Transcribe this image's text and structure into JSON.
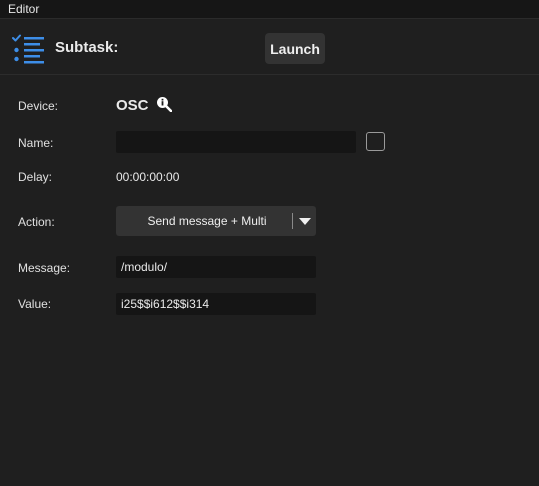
{
  "window": {
    "title": "Editor"
  },
  "header": {
    "subtask_label": "Subtask:",
    "launch_label": "Launch"
  },
  "form": {
    "device": {
      "label": "Device:",
      "value": "OSC"
    },
    "name": {
      "label": "Name:",
      "value": "",
      "checked": false
    },
    "delay": {
      "label": "Delay:",
      "value": "00:00:00:00"
    },
    "action": {
      "label": "Action:",
      "value": "Send message + Multi"
    },
    "message": {
      "label": "Message:",
      "value": "/modulo/"
    },
    "value": {
      "label": "Value:",
      "value": "i25$$i612$$i314"
    }
  },
  "icons": {
    "task_list": "task-list-icon",
    "info": "info-magnifier-icon",
    "dropdown": "caret-down-icon"
  },
  "colors": {
    "background": "#1f1f1f",
    "titlebar": "#161616",
    "accent": "#3d8ee8",
    "button": "#333333",
    "input": "#151515"
  }
}
